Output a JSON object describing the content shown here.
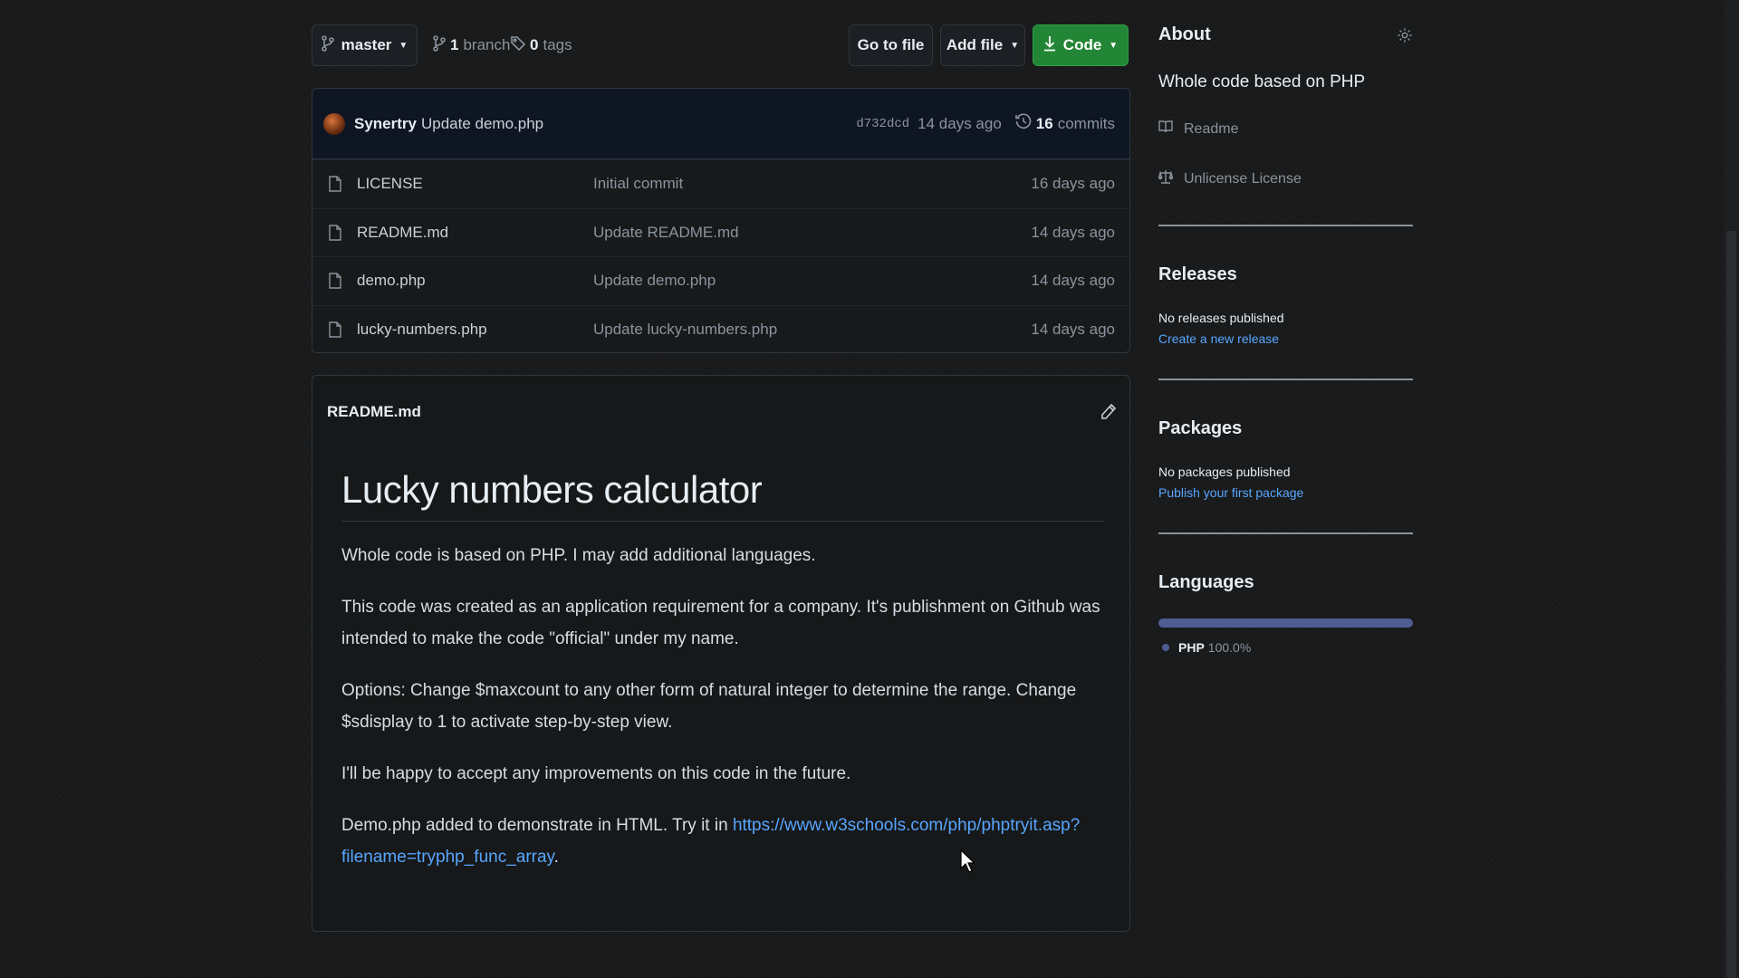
{
  "toolbar": {
    "branch_label": "master",
    "branches_count": "1",
    "branches_label": "branch",
    "tags_count": "0",
    "tags_label": "tags",
    "goto_label": "Go to file",
    "addfile_label": "Add file",
    "code_label": "Code"
  },
  "commit": {
    "author": "Synertry",
    "message": "Update demo.php",
    "sha": "d732dcd",
    "age": "14 days ago",
    "commits_count": "16",
    "commits_label": "commits"
  },
  "files": [
    {
      "name": "LICENSE",
      "commit": "Initial commit",
      "age": "16 days ago"
    },
    {
      "name": "README.md",
      "commit": "Update README.md",
      "age": "14 days ago"
    },
    {
      "name": "demo.php",
      "commit": "Update demo.php",
      "age": "14 days ago"
    },
    {
      "name": "lucky-numbers.php",
      "commit": "Update lucky-numbers.php",
      "age": "14 days ago"
    }
  ],
  "readme": {
    "filename": "README.md",
    "title": "Lucky numbers calculator",
    "p1": "Whole code is based on PHP. I may add additional languages.",
    "p2": "This code was created as an application requirement for a company. It's publishment on Github was intended to make the code \"official\" under my name.",
    "p3": "Options: Change $maxcount to any other form of natural integer to determine the range. Change $sdisplay to 1 to activate step-by-step view.",
    "p4": "I'll be happy to accept any improvements on this code in the future.",
    "p5_prefix": "Demo.php added to demonstrate in HTML. Try it in ",
    "p5_link": "https://www.w3schools.com/php/phptryit.asp?filename=tryphp_func_array",
    "p5_suffix": "."
  },
  "sidebar": {
    "about_title": "About",
    "about_desc": "Whole code based on PHP",
    "readme_label": "Readme",
    "license_label": "Unlicense License",
    "releases_title": "Releases",
    "releases_empty": "No releases published",
    "releases_link": "Create a new release",
    "packages_title": "Packages",
    "packages_empty": "No packages published",
    "packages_link": "Publish your first package",
    "languages_title": "Languages",
    "language_name": "PHP",
    "language_pct": "100.0%",
    "language_color": "#4f5d95"
  },
  "colors": {
    "accent_green": "#238636",
    "link_blue": "#58a6ff"
  },
  "icons": {
    "branch": "git-branch-icon",
    "tag": "tag-icon",
    "download": "download-icon",
    "history": "history-icon",
    "file": "file-icon",
    "pencil": "pencil-icon",
    "gear": "gear-icon",
    "book": "book-icon",
    "scale": "law-icon"
  }
}
